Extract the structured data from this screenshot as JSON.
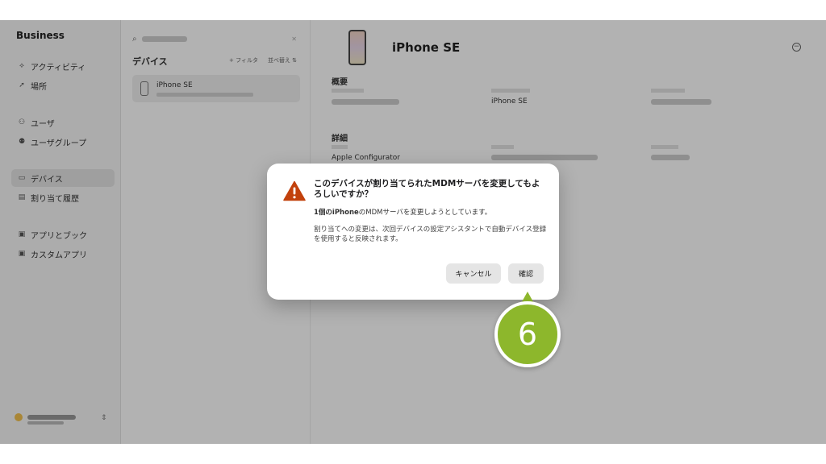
{
  "app": {
    "brand": "Business"
  },
  "sidebar": {
    "items": [
      {
        "label": "アクティビティ",
        "icon": "activity-icon"
      },
      {
        "label": "場所",
        "icon": "location-icon"
      },
      {
        "label": "ユーザ",
        "icon": "users-icon"
      },
      {
        "label": "ユーザグループ",
        "icon": "user-group-icon"
      },
      {
        "label": "デバイス",
        "icon": "laptop-icon",
        "active": true
      },
      {
        "label": "割り当て履歴",
        "icon": "history-icon"
      },
      {
        "label": "アプリとブック",
        "icon": "apps-icon"
      },
      {
        "label": "カスタムアプリ",
        "icon": "custom-app-icon"
      }
    ]
  },
  "list": {
    "title": "デバイス",
    "action1": "+ フィルタ",
    "action2": "並べ替え ⇅",
    "device_name": "iPhone SE"
  },
  "detail": {
    "title": "iPhone SE",
    "overview_title": "概要",
    "model_value": "iPhone SE",
    "details_title": "詳細",
    "source_value": "Apple Configurator"
  },
  "dialog": {
    "title": "このデバイスが割り当てられたMDMサーバを変更してもよろしいですか？",
    "message_bold": "1個のiPhone",
    "message_rest": "のMDMサーバを変更しようとしています。",
    "message2": "割り当てへの変更は、次回デバイスの設定アシスタントで自動デバイス登録を使用すると反映されます。",
    "cancel_label": "キャンセル",
    "confirm_label": "確認"
  },
  "callout": {
    "number": "6",
    "color": "#8db72c"
  },
  "colors": {
    "warning": "#c2410c",
    "overlay": "rgba(0,0,0,0.30)"
  }
}
